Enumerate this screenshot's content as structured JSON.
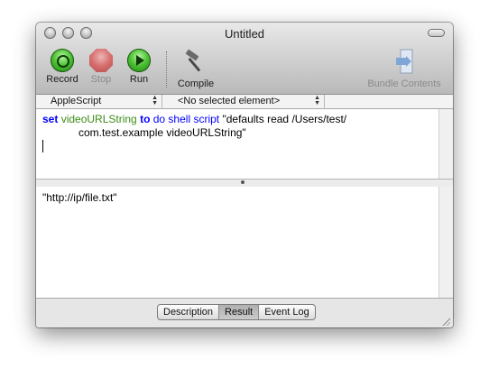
{
  "window": {
    "title": "Untitled"
  },
  "toolbar": {
    "record_label": "Record",
    "stop_label": "Stop",
    "run_label": "Run",
    "compile_label": "Compile",
    "bundle_label": "Bundle Contents"
  },
  "navbar": {
    "language": "AppleScript",
    "element": "<No selected element>"
  },
  "editor": {
    "tokens": {
      "set": "set",
      "variable": "videoURLString",
      "to": "to",
      "command": "do shell script",
      "string_part1": "\"defaults read /Users/test/",
      "string_part2": "com.test.example videoURLString\""
    }
  },
  "result": {
    "text": "\"http://ip/file.txt\""
  },
  "tabs": {
    "description": "Description",
    "result": "Result",
    "event_log": "Event Log",
    "selected": "Result"
  },
  "colors": {
    "keyword": "#0000ff",
    "variable": "#3c8c17",
    "record_green": "#4cc233",
    "stop_red": "#d95b5b"
  },
  "icons": [
    "close-icon",
    "minimize-icon",
    "zoom-icon",
    "toolbar-toggle-icon",
    "record-icon",
    "stop-icon",
    "run-icon",
    "hammer-icon",
    "bundle-contents-icon",
    "resize-grip-icon"
  ]
}
